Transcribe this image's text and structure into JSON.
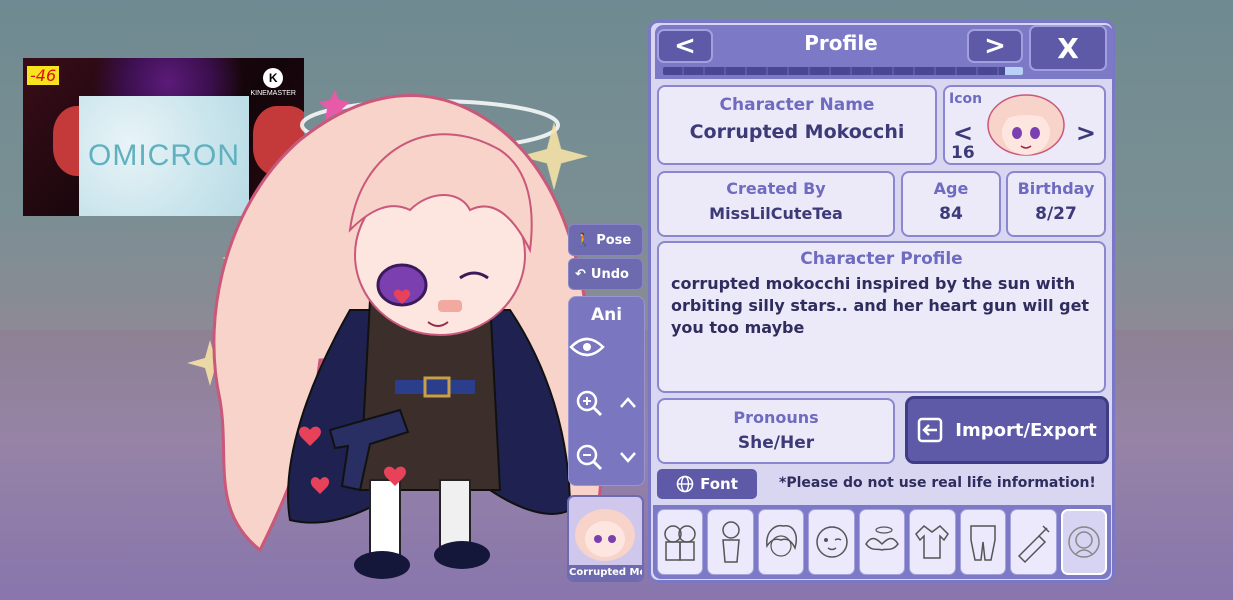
{
  "overlay": {
    "counter": "-46",
    "watermark": "KINEMASTER",
    "watermark_logo": "K",
    "video_text": "OMICRON"
  },
  "tools": {
    "pose_label": "Pose",
    "undo_label": "Undo",
    "ani_label": "Ani",
    "thumb_name": "Corrupted Mo"
  },
  "profile": {
    "title": "Profile",
    "prev": "<",
    "next": ">",
    "close": "X",
    "progress": 0.95,
    "character_name_label": "Character Name",
    "character_name": "Corrupted Mokocchi",
    "icon_label": "Icon",
    "icon_index": "16",
    "icon_prev": "<",
    "icon_next": ">",
    "created_by_label": "Created By",
    "created_by": "MissLilCuteTea",
    "age_label": "Age",
    "age": "84",
    "birthday_label": "Birthday",
    "birthday": "8/27",
    "character_profile_label": "Character Profile",
    "character_profile_text": "corrupted mokocchi inspired by the sun with orbiting silly stars.. and her heart gun will get you too maybe",
    "pronouns_label": "Pronouns",
    "pronouns": "She/Her",
    "import_export_label": "Import/Export",
    "font_label": "Font",
    "warning": "*Please do not use real life information!"
  },
  "tabs": [
    {
      "name": "presets-icon"
    },
    {
      "name": "body-icon"
    },
    {
      "name": "hair-icon"
    },
    {
      "name": "face-icon"
    },
    {
      "name": "accessories-icon"
    },
    {
      "name": "top-icon"
    },
    {
      "name": "bottom-icon"
    },
    {
      "name": "props-icon"
    },
    {
      "name": "profile-icon",
      "active": true
    }
  ],
  "colors": {
    "panel_bg": "#d9d6f2",
    "header": "#7c79c7",
    "button": "#5e5aa8",
    "label": "#6f6bc0"
  }
}
